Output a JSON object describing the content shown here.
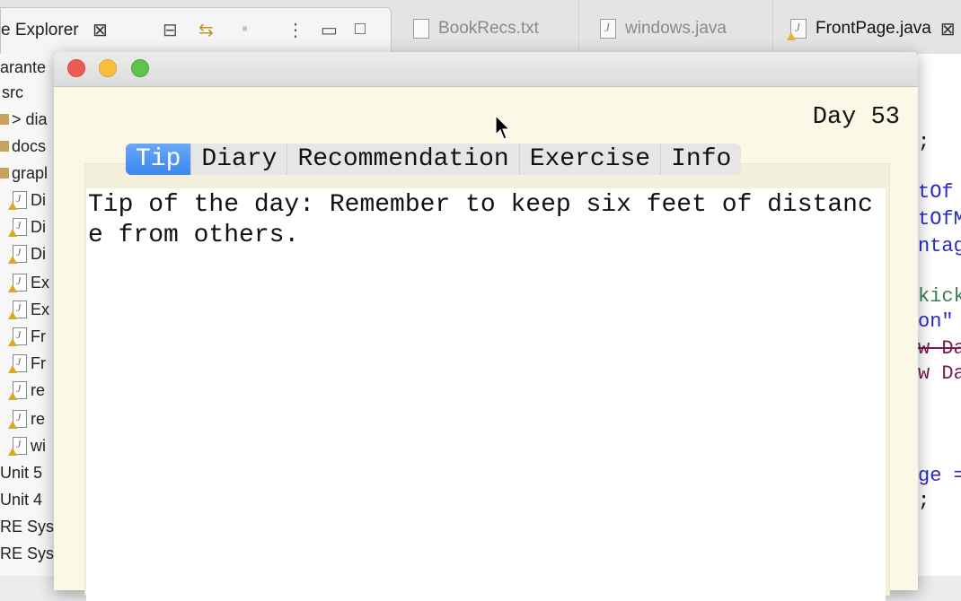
{
  "ide": {
    "view_tab": {
      "label": "e Explorer"
    },
    "editor_tabs": [
      {
        "label": "BookRecs.txt",
        "active": false
      },
      {
        "label": "windows.java",
        "active": false
      },
      {
        "label": "FrontPage.java",
        "active": true
      }
    ],
    "explorer_items": [
      "arante",
      "src",
      "> dia",
      "docs",
      "grapl",
      "Di",
      "Di",
      "Di",
      "Ex",
      "Ex",
      "Fr",
      "Fr",
      "re",
      "re",
      "wi",
      "Unit 5",
      "Unit 4",
      "RE Sys",
      "RE Sys"
    ],
    "editor_code_fragments": [
      ";",
      "tOf",
      "tOfM",
      "ntag",
      "kick",
      "on\"",
      "w Da",
      "w Da",
      "ge =",
      ";"
    ],
    "colors": {
      "code_blue": "#2a2ac8",
      "code_green": "#3b7f5a"
    }
  },
  "app": {
    "day_label": "Day 53",
    "tabs": [
      {
        "label": "Tip",
        "selected": true
      },
      {
        "label": "Diary",
        "selected": false
      },
      {
        "label": "Recommendation",
        "selected": false
      },
      {
        "label": "Exercise",
        "selected": false
      },
      {
        "label": "Info",
        "selected": false
      }
    ],
    "content": "Tip of the day: Remember to keep six feet of distance from others.",
    "colors": {
      "selected_tab": "#4a90f0",
      "window_bg": "#fbf9e6"
    }
  }
}
